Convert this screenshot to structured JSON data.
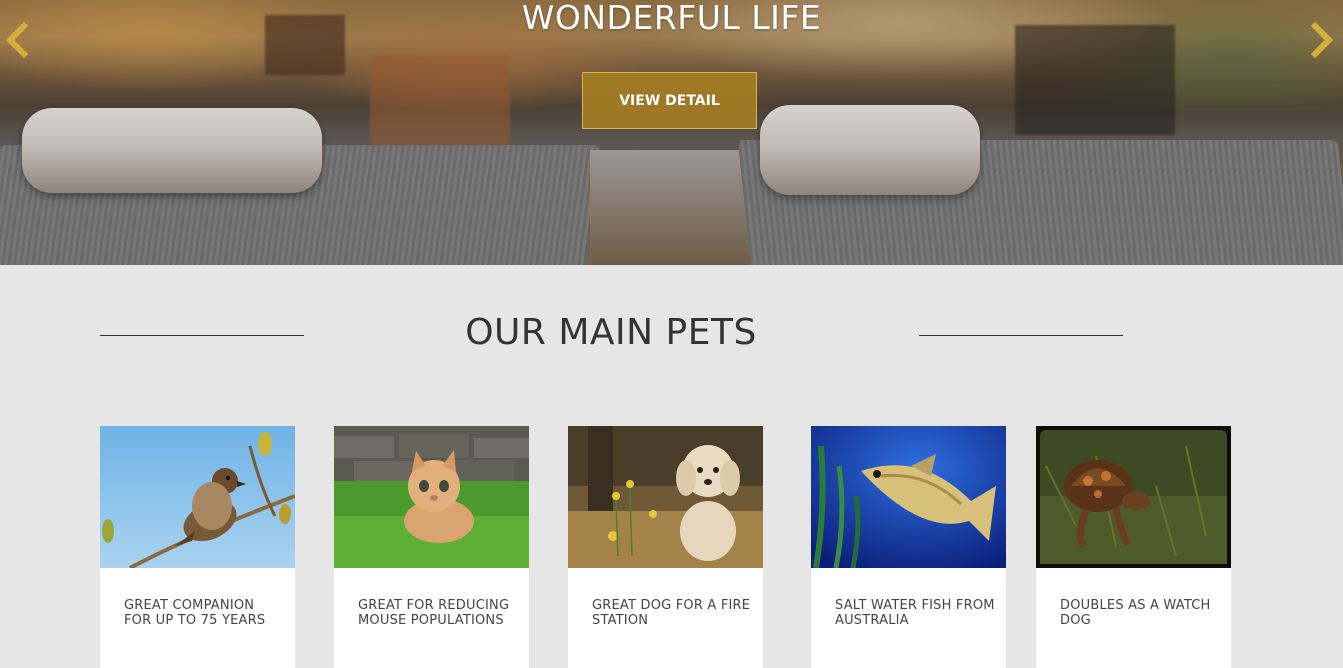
{
  "hero": {
    "title": "WONDERFUL LIFE",
    "button_label": "VIEW DETAIL",
    "prev_icon": "chevron-left-icon",
    "next_icon": "chevron-right-icon",
    "accent_color": "#d4b03a"
  },
  "section": {
    "title": "OUR MAIN PETS"
  },
  "cards": [
    {
      "animal": "sparrow",
      "caption": "GREAT COMPANION FOR UP TO 75 YEARS"
    },
    {
      "animal": "kitten",
      "caption": "GREAT FOR REDUCING MOUSE POPULATIONS"
    },
    {
      "animal": "puppy",
      "caption": "GREAT DOG FOR A FIRE STATION"
    },
    {
      "animal": "fish",
      "caption": "SALT WATER FISH FROM AUSTRALIA"
    },
    {
      "animal": "turtle",
      "caption": "DOUBLES AS A WATCH DOG"
    }
  ]
}
